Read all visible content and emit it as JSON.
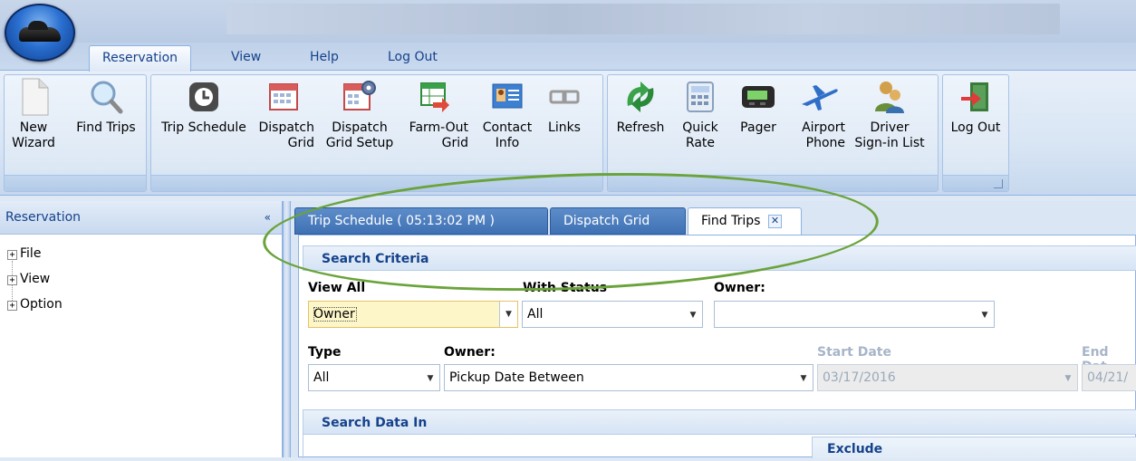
{
  "app": {
    "orb_icon": "car-icon"
  },
  "ribbon_tabs": [
    {
      "label": "Reservation",
      "active": true
    },
    {
      "label": "View"
    },
    {
      "label": "Help"
    },
    {
      "label": "Log Out"
    }
  ],
  "ribbon_buttons": {
    "new_wizard": "New\nWizard",
    "find_trips": "Find Trips",
    "trip_schedule": "Trip Schedule",
    "dispatch_grid": "Dispatch\nGrid",
    "dispatch_grid_setup": "Dispatch\nGrid Setup",
    "farm_out_grid": "Farm-Out\nGrid",
    "contact_info": "Contact\nInfo",
    "links": "Links",
    "refresh": "Refresh",
    "quick_rate": "Quick\nRate",
    "pager": "Pager",
    "airport_phone": "Airport\nPhone",
    "driver_signin_list": "Driver\nSign-in List",
    "log_out": "Log Out"
  },
  "left_panel": {
    "title": "Reservation",
    "collapse_glyph": "«",
    "tree": [
      {
        "label": "File",
        "expander": "+"
      },
      {
        "label": "View",
        "expander": "+"
      },
      {
        "label": "Option",
        "expander": "+"
      }
    ]
  },
  "doc_tabs": [
    {
      "label": "Trip Schedule  ( 05:13:02 PM )"
    },
    {
      "label": "Dispatch Grid"
    },
    {
      "label": "Find Trips",
      "active": true,
      "close": "✕"
    }
  ],
  "search_criteria": {
    "header": "Search Criteria",
    "view_all_label": "View All",
    "view_all_value": "Owner",
    "with_status_label": "With Status",
    "with_status_value": "All",
    "owner_label_1": "Owner:",
    "owner_value_1": "",
    "type_label": "Type",
    "type_value": "All",
    "owner_label_2": "Owner:",
    "owner_value_2": "Pickup Date Between",
    "start_date_label": "Start Date",
    "start_date_value": "03/17/2016",
    "end_date_label": "End Dat",
    "end_date_value": "04/21/"
  },
  "search_data_in": {
    "header": "Search Data In",
    "exclude_label": "Exclude"
  },
  "colors": {
    "ribbon_text": "#15428b",
    "highlight_ellipse": "#6aa33a",
    "tab_active_bg": "#ffffff",
    "tab_inactive_bg": "#4a7cbd"
  }
}
